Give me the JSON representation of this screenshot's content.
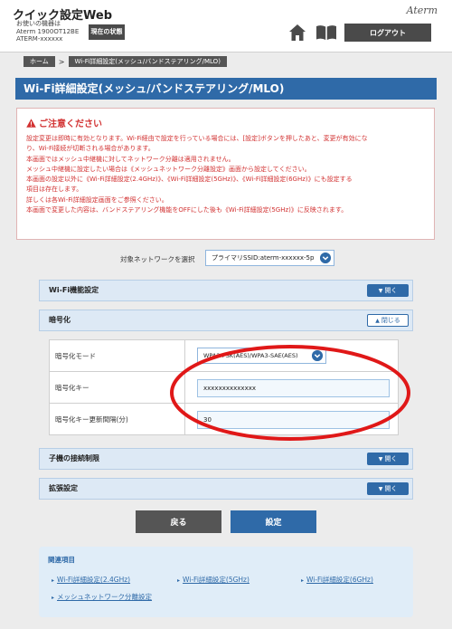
{
  "header": {
    "app_title": "クイック設定Web",
    "device_line1": "お使いの機器は",
    "device_line2": "Aterm 1900OT12BE",
    "device_line3": "ATERM-xxxxxx",
    "status_button": "現在の状態",
    "brand": "Aterm",
    "logout_button": "ログアウト"
  },
  "breadcrumb": {
    "home": "ホーム",
    "separator": ">",
    "current": "Wi-Fi詳細設定(メッシュ/バンドステアリング/MLO)"
  },
  "page_title": "Wi-Fi詳細設定(メッシュ/バンドステアリング/MLO)",
  "notice": {
    "title": "ご注意ください",
    "lines": [
      "設定変更は即時に有効となります。Wi-Fi経由で設定を行っている場合には、[設定]ボタンを押したあと、変更が有効にな",
      "り、Wi-Fi接続が切断される場合があります。",
      "本画面ではメッシュ中継機に対してネットワーク分離は適用されません。",
      "メッシュ中継機に設定したい場合は《メッシュネットワーク分離設定》画面から設定してください。",
      "本画面の設定以外に《Wi-Fi詳細設定(2.4GHz)》、《Wi-Fi詳細設定(5GHz)》、《Wi-Fi詳細設定(6GHz)》にも設定する",
      "項目は存在します。",
      "詳しくは各Wi-Fi詳細設定画面をご参照ください。",
      "本画面で変更した内容は、バンドステアリング機能をOFFにした後も《Wi-Fi詳細設定(5GHz)》に反映されます。"
    ]
  },
  "target_network": {
    "label": "対象ネットワークを選択",
    "selected": "プライマリSSID:aterm-xxxxxx-5p"
  },
  "sections": {
    "wifi_function": {
      "title": "Wi-Fi機能設定",
      "toggle": "開く"
    },
    "encryption": {
      "title": "暗号化",
      "toggle": "閉じる"
    },
    "child_limit": {
      "title": "子機の接続制限",
      "toggle": "開く"
    },
    "extended": {
      "title": "拡張設定",
      "toggle": "開く"
    }
  },
  "encryption": {
    "mode_label": "暗号化モード",
    "mode_value": "WPA2-PSK(AES)/WPA3-SAE(AES)",
    "key_label": "暗号化キー",
    "key_value": "xxxxxxxxxxxxxx",
    "interval_label": "暗号化キー更新間隔(分)",
    "interval_value": "30"
  },
  "actions": {
    "back": "戻る",
    "save": "設定"
  },
  "related": {
    "title": "関連項目",
    "links": [
      "Wi-Fi詳細設定(2.4GHz)",
      "Wi-Fi詳細設定(5GHz)",
      "Wi-Fi詳細設定(6GHz)",
      "メッシュネットワーク分離設定"
    ]
  },
  "colors": {
    "accent": "#2f6aa8",
    "warning": "#d23232",
    "annotation": "#e01818"
  }
}
